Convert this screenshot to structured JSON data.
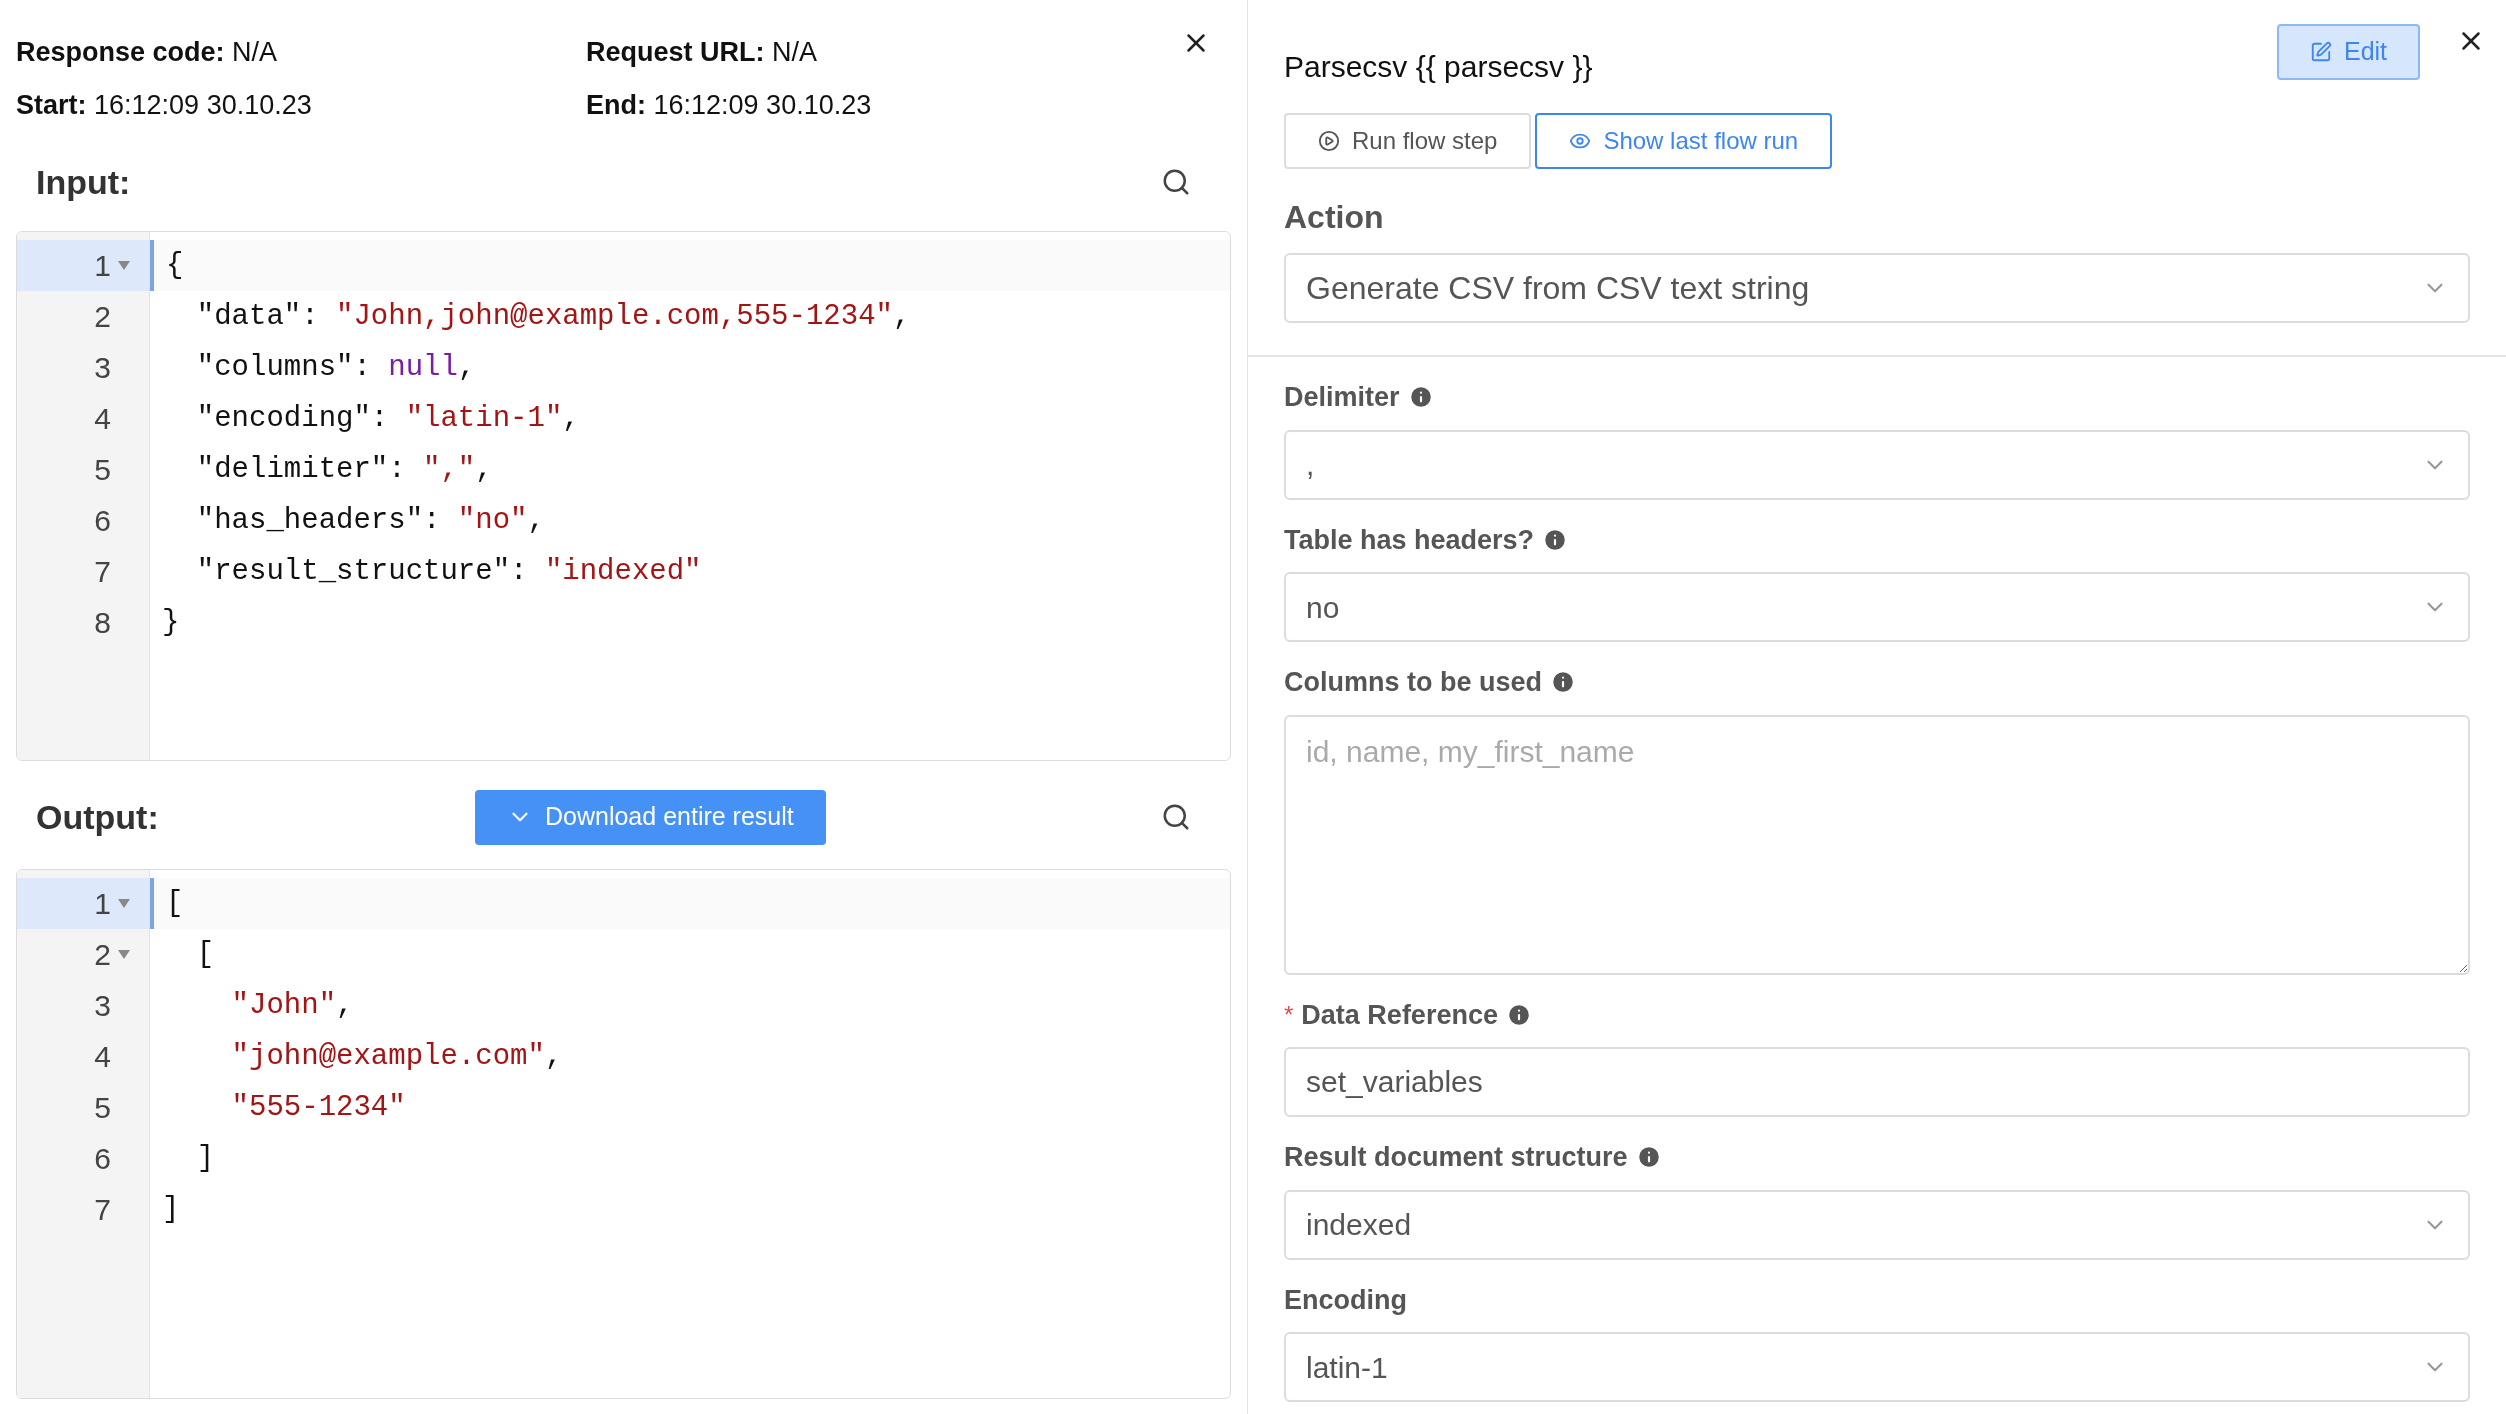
{
  "run_info": {
    "items": [
      {
        "label": "Response code:",
        "value": "N/A"
      },
      {
        "label": "Request URL:",
        "value": "N/A"
      },
      {
        "label": "Start:",
        "value": "16:12:09 30.10.23"
      },
      {
        "label": "End:",
        "value": "16:12:09 30.10.23"
      }
    ]
  },
  "input": {
    "title": "Input:",
    "lines": [
      {
        "number": "1",
        "foldable": true,
        "active": true,
        "tokens": [
          {
            "kind": "punct",
            "text": "{"
          }
        ]
      },
      {
        "number": "2",
        "foldable": false,
        "active": false,
        "tokens": [
          {
            "kind": "key",
            "text": "  \"data\""
          },
          {
            "kind": "punct",
            "text": ": "
          },
          {
            "kind": "string",
            "text": "\"John,john@example.com,555-1234\""
          },
          {
            "kind": "punct",
            "text": ","
          }
        ]
      },
      {
        "number": "3",
        "foldable": false,
        "active": false,
        "tokens": [
          {
            "kind": "key",
            "text": "  \"columns\""
          },
          {
            "kind": "punct",
            "text": ": "
          },
          {
            "kind": "null",
            "text": "null"
          },
          {
            "kind": "punct",
            "text": ","
          }
        ]
      },
      {
        "number": "4",
        "foldable": false,
        "active": false,
        "tokens": [
          {
            "kind": "key",
            "text": "  \"encoding\""
          },
          {
            "kind": "punct",
            "text": ": "
          },
          {
            "kind": "string",
            "text": "\"latin-1\""
          },
          {
            "kind": "punct",
            "text": ","
          }
        ]
      },
      {
        "number": "5",
        "foldable": false,
        "active": false,
        "tokens": [
          {
            "kind": "key",
            "text": "  \"delimiter\""
          },
          {
            "kind": "punct",
            "text": ": "
          },
          {
            "kind": "string",
            "text": "\",\""
          },
          {
            "kind": "punct",
            "text": ","
          }
        ]
      },
      {
        "number": "6",
        "foldable": false,
        "active": false,
        "tokens": [
          {
            "kind": "key",
            "text": "  \"has_headers\""
          },
          {
            "kind": "punct",
            "text": ": "
          },
          {
            "kind": "string",
            "text": "\"no\""
          },
          {
            "kind": "punct",
            "text": ","
          }
        ]
      },
      {
        "number": "7",
        "foldable": false,
        "active": false,
        "tokens": [
          {
            "kind": "key",
            "text": "  \"result_structure\""
          },
          {
            "kind": "punct",
            "text": ": "
          },
          {
            "kind": "string",
            "text": "\"indexed\""
          }
        ]
      },
      {
        "number": "8",
        "foldable": false,
        "active": false,
        "tokens": [
          {
            "kind": "punct",
            "text": "}"
          }
        ]
      }
    ]
  },
  "output": {
    "title": "Output:",
    "download_button": "Download entire result",
    "lines": [
      {
        "number": "1",
        "foldable": true,
        "active": true,
        "tokens": [
          {
            "kind": "punct",
            "text": "["
          }
        ]
      },
      {
        "number": "2",
        "foldable": true,
        "active": false,
        "tokens": [
          {
            "kind": "punct",
            "text": "  ["
          }
        ]
      },
      {
        "number": "3",
        "foldable": false,
        "active": false,
        "tokens": [
          {
            "kind": "string",
            "text": "    \"John\""
          },
          {
            "kind": "punct",
            "text": ","
          }
        ]
      },
      {
        "number": "4",
        "foldable": false,
        "active": false,
        "tokens": [
          {
            "kind": "string",
            "text": "    \"john@example.com\""
          },
          {
            "kind": "punct",
            "text": ","
          }
        ]
      },
      {
        "number": "5",
        "foldable": false,
        "active": false,
        "tokens": [
          {
            "kind": "string",
            "text": "    \"555-1234\""
          }
        ]
      },
      {
        "number": "6",
        "foldable": false,
        "active": false,
        "tokens": [
          {
            "kind": "punct",
            "text": "  ]"
          }
        ]
      },
      {
        "number": "7",
        "foldable": false,
        "active": false,
        "tokens": [
          {
            "kind": "punct",
            "text": "]"
          }
        ]
      }
    ]
  },
  "step_panel": {
    "title": "Parsecsv {{ parsecsv }}",
    "edit_button": "Edit",
    "run_button": "Run flow step",
    "show_button": "Show last flow run",
    "action": {
      "label": "Action",
      "value": "Generate CSV from CSV text string"
    },
    "fields": [
      {
        "kind": "select",
        "label": "Delimiter",
        "info": true,
        "value": ","
      },
      {
        "kind": "select",
        "label": "Table has headers?",
        "info": true,
        "value": "no"
      },
      {
        "kind": "textarea",
        "label": "Columns to be used",
        "info": true,
        "placeholder": "id, name, my_first_name"
      },
      {
        "kind": "input",
        "label": "Data Reference",
        "info": true,
        "required_mark": "*",
        "value": "set_variables"
      },
      {
        "kind": "select",
        "label": "Result document structure",
        "info": true,
        "value": "indexed"
      },
      {
        "kind": "select",
        "label": "Encoding",
        "info": false,
        "value": "latin-1"
      }
    ]
  }
}
